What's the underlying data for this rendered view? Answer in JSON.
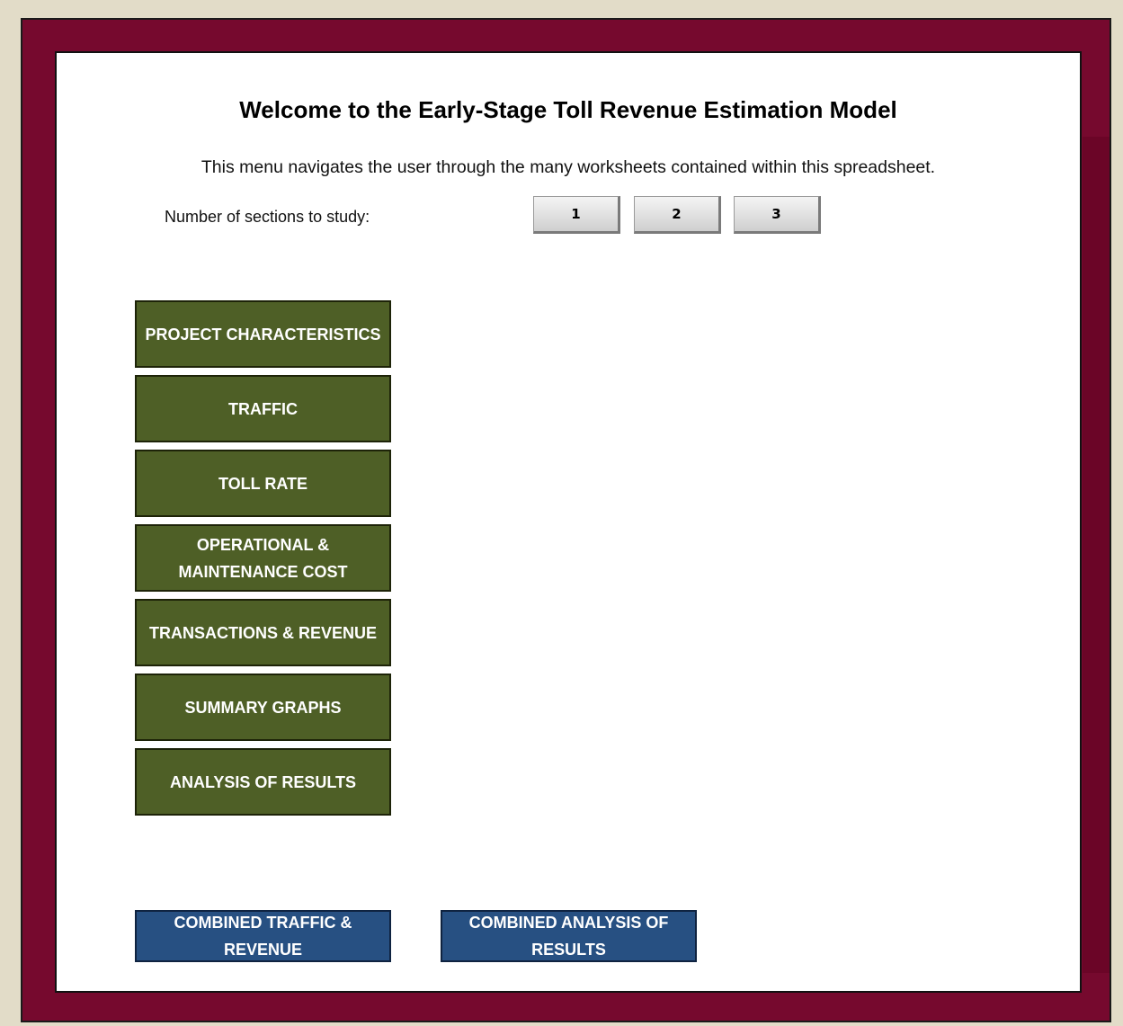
{
  "header": {
    "title": "Welcome to the Early-Stage Toll Revenue Estimation Model",
    "subtitle": "This menu navigates the user through the many worksheets contained within this spreadsheet."
  },
  "sections": {
    "label": "Number of sections to study:",
    "options": [
      "1",
      "2",
      "3"
    ]
  },
  "nav": {
    "items": [
      "PROJECT CHARACTERISTICS",
      "TRAFFIC",
      "TOLL RATE",
      "OPERATIONAL & MAINTENANCE COST",
      "TRANSACTIONS & REVENUE",
      "SUMMARY GRAPHS",
      "ANALYSIS OF RESULTS"
    ]
  },
  "combined": {
    "items": [
      "COMBINED TRAFFIC & REVENUE",
      "COMBINED ANALYSIS OF RESULTS"
    ]
  },
  "colors": {
    "frame": "#76092e",
    "nav_button": "#4e5f26",
    "combined_button": "#275082",
    "background": "#e2dcc8"
  }
}
